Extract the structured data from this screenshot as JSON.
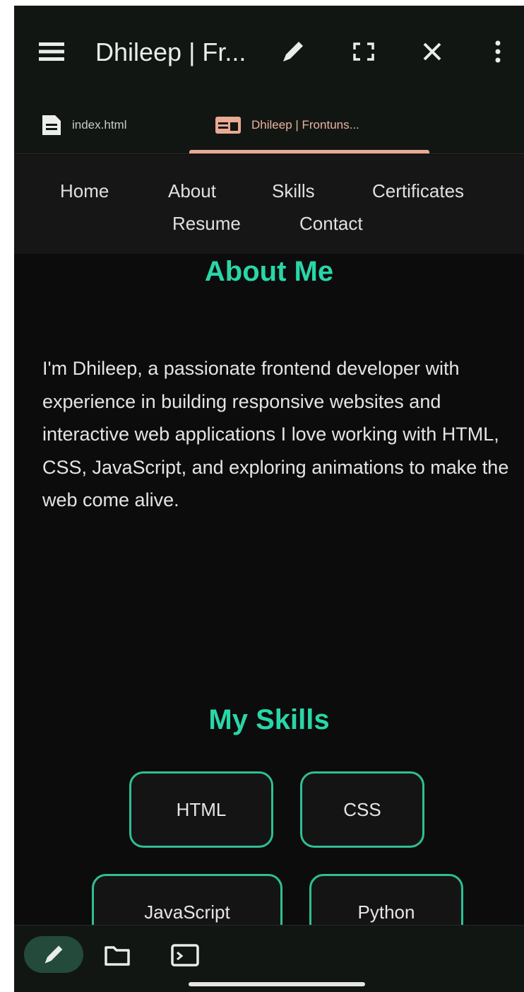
{
  "app_bar": {
    "title": "Dhileep | Fr...",
    "icons": {
      "menu": "menu-icon",
      "edit": "pencil-icon",
      "fullscreen": "fullscreen-icon",
      "close": "close-icon",
      "more": "more-vertical-icon"
    }
  },
  "tabs": [
    {
      "label": "index.html",
      "icon": "file-icon",
      "active": false
    },
    {
      "label": "Dhileep | Frontuns...",
      "icon": "browser-window-icon",
      "active": true
    }
  ],
  "site_nav": {
    "links": [
      "Home",
      "About",
      "Skills",
      "Certificates",
      "Resume",
      "Contact"
    ]
  },
  "about": {
    "title": "About Me",
    "text": "I'm Dhileep, a passionate frontend developer with experience in building responsive websites and interactive web applications I love working with HTML, CSS, JavaScript, and exploring animations to make the web come alive."
  },
  "skills": {
    "title": "My Skills",
    "items": [
      "HTML",
      "CSS",
      "JavaScript",
      "Python"
    ]
  },
  "bottom_bar": {
    "icons": {
      "edit": "pencil-icon",
      "files": "folder-icon",
      "preview": "terminal-icon"
    }
  },
  "colors": {
    "accent": "#29d6a8",
    "card_border": "#2fbf95",
    "tab_indicator": "#e9a995",
    "background": "#0b0c0b"
  }
}
